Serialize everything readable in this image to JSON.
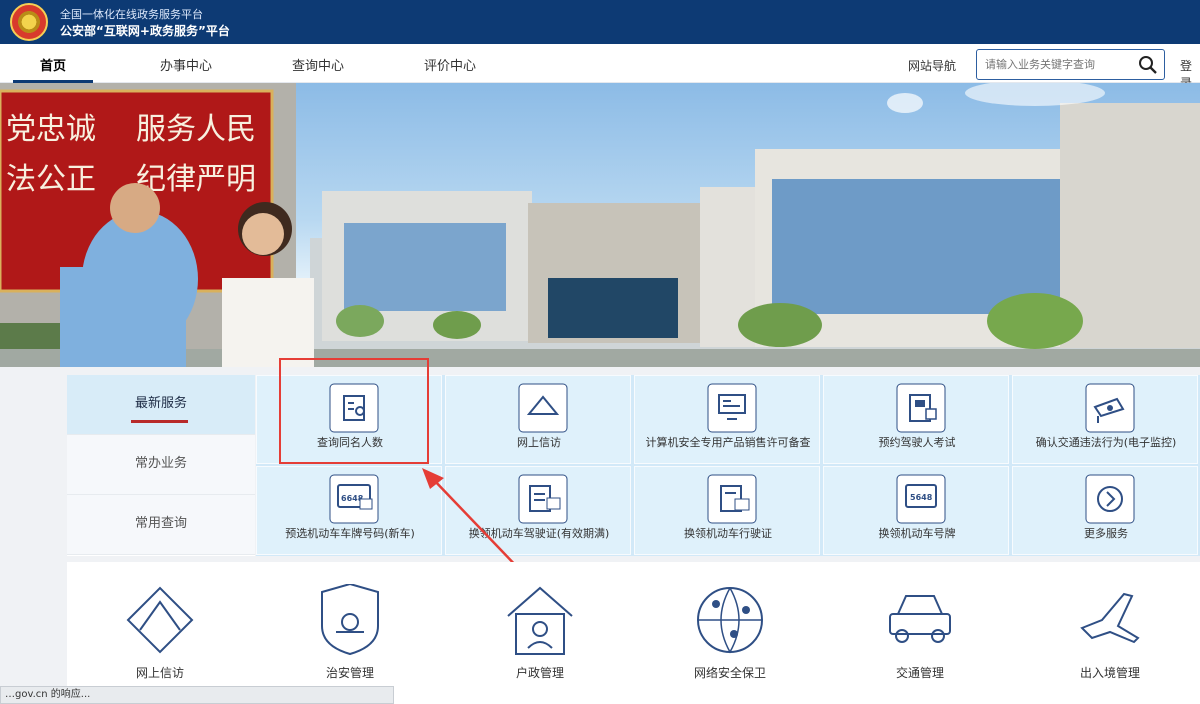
{
  "header": {
    "subtitle": "全国一体化在线政务服务平台",
    "title": "公安部“互联网+政务服务”平台"
  },
  "nav": {
    "home": "首页",
    "service": "办事中心",
    "query": "查询中心",
    "evaluate": "评价中心",
    "site_nav": "网站导航",
    "search_placeholder": "请输入业务关键字查询",
    "login": "登录"
  },
  "hero": {
    "slogan_1": "党忠诚",
    "slogan_2": "服务人民",
    "slogan_3": "法公正",
    "slogan_4": "纪律严明"
  },
  "tabs": [
    {
      "label": "最新服务"
    },
    {
      "label": "常办业务"
    },
    {
      "label": "常用查询"
    }
  ],
  "services": [
    {
      "label": "查询同名人数",
      "icon": "search-person-icon"
    },
    {
      "label": "网上信访",
      "icon": "letter-icon"
    },
    {
      "label": "计算机安全专用产品销售许可备查",
      "icon": "computer-certificate-icon"
    },
    {
      "label": "预约驾驶人考试",
      "icon": "driving-test-icon"
    },
    {
      "label": "确认交通违法行为(电子监控)",
      "icon": "camera-icon"
    },
    {
      "label": "预选机动车车牌号码(新车)",
      "icon": "plate-select-icon"
    },
    {
      "label": "换领机动车驾驶证(有效期满)",
      "icon": "license-card-icon"
    },
    {
      "label": "换领机动车行驶证",
      "icon": "vehicle-license-icon"
    },
    {
      "label": "换领机动车号牌",
      "icon": "plate-icon"
    },
    {
      "label": "更多服务",
      "icon": "chevron-right-icon"
    }
  ],
  "categories": [
    {
      "label": "网上信访",
      "icon": "letter-icon"
    },
    {
      "label": "治安管理",
      "icon": "police-shield-icon"
    },
    {
      "label": "户政管理",
      "icon": "household-icon"
    },
    {
      "label": "网络安全保卫",
      "icon": "network-globe-icon"
    },
    {
      "label": "交通管理",
      "icon": "car-icon"
    },
    {
      "label": "出入境管理",
      "icon": "airplane-icon"
    }
  ],
  "status": "…gov.cn 的响应..."
}
